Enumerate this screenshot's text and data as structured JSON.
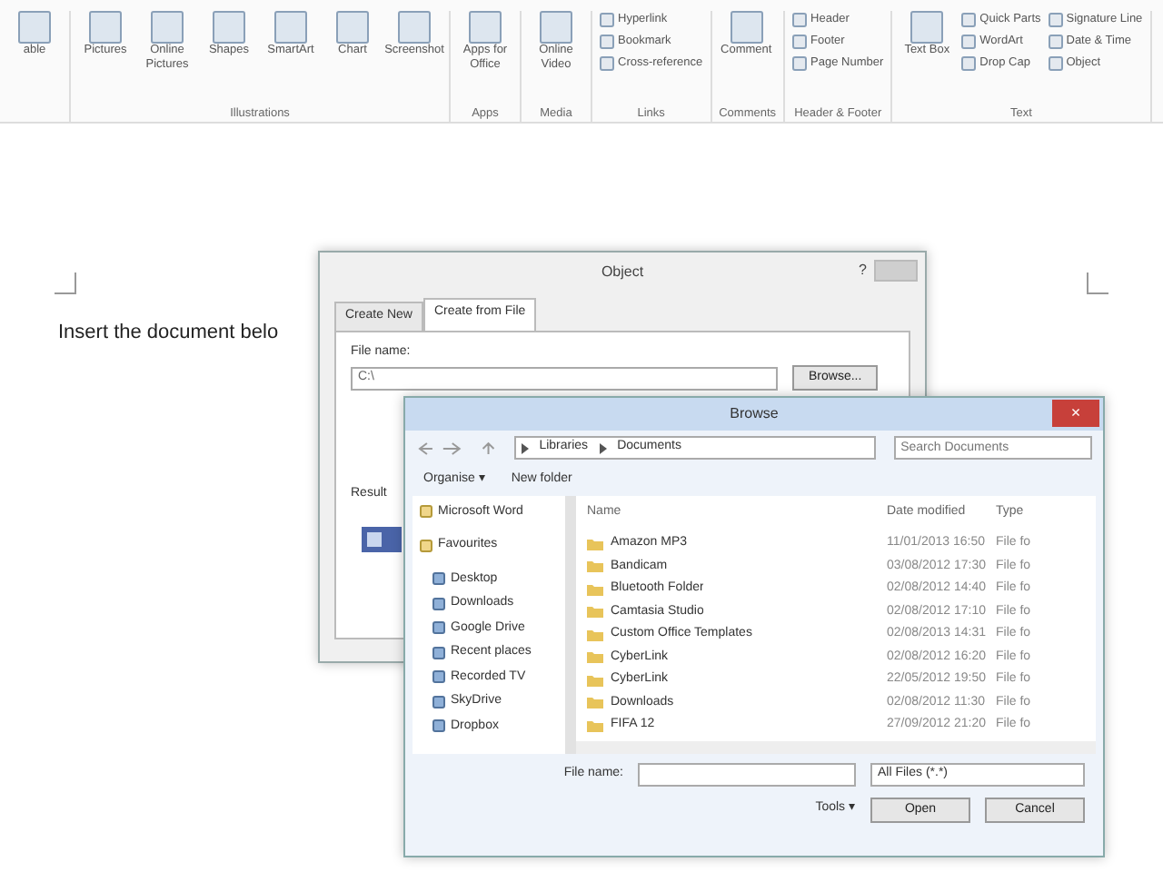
{
  "ribbon": {
    "groups": [
      {
        "items": [
          {
            "label": "able",
            "kind": "large"
          }
        ]
      },
      {
        "label": "Illustrations",
        "items": [
          {
            "label": "Pictures",
            "kind": "large"
          },
          {
            "label": "Online Pictures",
            "kind": "large"
          },
          {
            "label": "Shapes",
            "kind": "large"
          },
          {
            "label": "SmartArt",
            "kind": "large"
          },
          {
            "label": "Chart",
            "kind": "large"
          },
          {
            "label": "Screenshot",
            "kind": "large"
          }
        ]
      },
      {
        "label": "Apps",
        "items": [
          {
            "label": "Apps for Office",
            "kind": "large"
          }
        ]
      },
      {
        "label": "Media",
        "items": [
          {
            "label": "Online Video",
            "kind": "large"
          }
        ]
      },
      {
        "label": "Links",
        "items": [
          {
            "label": "Hyperlink",
            "kind": "small"
          },
          {
            "label": "Bookmark",
            "kind": "small"
          },
          {
            "label": "Cross-reference",
            "kind": "small"
          }
        ]
      },
      {
        "label": "Comments",
        "items": [
          {
            "label": "Comment",
            "kind": "large"
          }
        ]
      },
      {
        "label": "Header & Footer",
        "items": [
          {
            "label": "Header",
            "kind": "small"
          },
          {
            "label": "Footer",
            "kind": "small"
          },
          {
            "label": "Page Number",
            "kind": "small"
          }
        ]
      },
      {
        "label": "Text",
        "items": [
          {
            "label": "Text Box",
            "kind": "large"
          },
          {
            "label": "Quick Parts",
            "kind": "small"
          },
          {
            "label": "WordArt",
            "kind": "small"
          },
          {
            "label": "Drop Cap",
            "kind": "small"
          },
          {
            "label": "Signature Line",
            "kind": "small"
          },
          {
            "label": "Date & Time",
            "kind": "small"
          },
          {
            "label": "Object",
            "kind": "small"
          }
        ]
      }
    ]
  },
  "document": {
    "text": "Insert the document belo"
  },
  "object_dialog": {
    "title": "Object",
    "help": "?",
    "tabs": [
      {
        "label": "Create New",
        "selected": false
      },
      {
        "label": "Create from File",
        "selected": true
      }
    ],
    "file_name_label": "File name:",
    "file_name_value": "C:\\",
    "browse_button": "Browse...",
    "result_label": "Result"
  },
  "browse_dialog": {
    "title": "Browse",
    "close": "×",
    "path": [
      "Libraries",
      "Documents"
    ],
    "search_placeholder": "Search Documents",
    "toolbar": [
      "Organise ▾",
      "New folder"
    ],
    "nav_items": [
      {
        "label": "Microsoft Word",
        "kind": "heading"
      },
      {
        "label": "Favourites",
        "kind": "heading"
      },
      {
        "label": "Desktop",
        "kind": "item"
      },
      {
        "label": "Downloads",
        "kind": "item"
      },
      {
        "label": "Google Drive",
        "kind": "item"
      },
      {
        "label": "Recent places",
        "kind": "item"
      },
      {
        "label": "Recorded TV",
        "kind": "item"
      },
      {
        "label": "SkyDrive",
        "kind": "item"
      },
      {
        "label": "Dropbox",
        "kind": "item"
      }
    ],
    "columns": [
      "Name",
      "Date modified",
      "Type"
    ],
    "rows": [
      {
        "name": "Amazon MP3",
        "date": "11/01/2013 16:50",
        "type": "File fo"
      },
      {
        "name": "Bandicam",
        "date": "03/08/2012 17:30",
        "type": "File fo"
      },
      {
        "name": "Bluetooth Folder",
        "date": "02/08/2012 14:40",
        "type": "File fo"
      },
      {
        "name": "Camtasia Studio",
        "date": "02/08/2012 17:10",
        "type": "File fo"
      },
      {
        "name": "Custom Office Templates",
        "date": "02/08/2013 14:31",
        "type": "File fo"
      },
      {
        "name": "CyberLink",
        "date": "02/08/2012 16:20",
        "type": "File fo"
      },
      {
        "name": "CyberLink",
        "date": "22/05/2012 19:50",
        "type": "File fo"
      },
      {
        "name": "Downloads",
        "date": "02/08/2012 11:30",
        "type": "File fo"
      },
      {
        "name": "FIFA 12",
        "date": "27/09/2012 21:20",
        "type": "File fo"
      }
    ],
    "file_name_label": "File name:",
    "file_type": "All Files (*.*)",
    "tools": "Tools ▾",
    "buttons": [
      "Open",
      "Cancel"
    ]
  }
}
